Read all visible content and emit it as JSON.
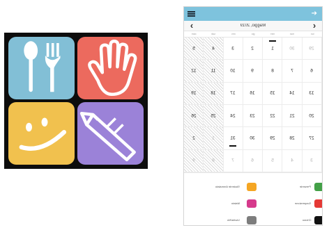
{
  "calendar": {
    "month_title": "Maggio, 2019",
    "weekdays": [
      "dom",
      "sab",
      "ven",
      "gio",
      "mer",
      "mar",
      "lun"
    ],
    "rows": [
      [
        {
          "d": "5",
          "hatch": true
        },
        {
          "d": "4",
          "hatch": true
        },
        {
          "d": "3"
        },
        {
          "d": "2"
        },
        {
          "d": "1",
          "mark": "top"
        },
        {
          "d": "30",
          "dim": true
        },
        {
          "d": "29",
          "dim": true
        }
      ],
      [
        {
          "d": "12",
          "hatch": true
        },
        {
          "d": "11",
          "hatch": true
        },
        {
          "d": "10"
        },
        {
          "d": "9"
        },
        {
          "d": "8"
        },
        {
          "d": "7"
        },
        {
          "d": "6"
        }
      ],
      [
        {
          "d": "19",
          "hatch": true
        },
        {
          "d": "18",
          "hatch": true
        },
        {
          "d": "17"
        },
        {
          "d": "16"
        },
        {
          "d": "15"
        },
        {
          "d": "14"
        },
        {
          "d": "13"
        }
      ],
      [
        {
          "d": "26",
          "hatch": true
        },
        {
          "d": "25",
          "hatch": true
        },
        {
          "d": "24"
        },
        {
          "d": "23"
        },
        {
          "d": "22"
        },
        {
          "d": "21"
        },
        {
          "d": "20"
        }
      ],
      [
        {
          "d": "2",
          "hatch": true
        },
        {
          "d": "1",
          "hatch": true,
          "dim": true
        },
        {
          "d": "31",
          "mark": "bottom"
        },
        {
          "d": "30"
        },
        {
          "d": "29"
        },
        {
          "d": "28"
        },
        {
          "d": "27"
        }
      ],
      [
        {
          "d": "9",
          "hatch": true,
          "dim": true
        },
        {
          "d": "8",
          "hatch": true,
          "dim": true
        },
        {
          "d": "7",
          "dim": true
        },
        {
          "d": "6",
          "dim": true
        },
        {
          "d": "5",
          "dim": true
        },
        {
          "d": "4",
          "dim": true
        },
        {
          "d": "3",
          "dim": true
        }
      ]
    ]
  },
  "legend": {
    "left": [
      {
        "label": "Studente Ammalato",
        "color": "#f5a623"
      },
      {
        "label": "Malato",
        "color": "#d63a8c"
      },
      {
        "label": "Uscita/Mo",
        "color": "#7d7d7d"
      }
    ],
    "right": [
      {
        "label": "Presente",
        "color": "#43a047"
      },
      {
        "label": "Sospensione",
        "color": "#e53935"
      },
      {
        "label": "Chiuso",
        "color": "#111111"
      }
    ]
  },
  "colors": {
    "appbar": "#7ec3dd",
    "logo_food": "#82bfd6",
    "logo_hand": "#ec6a5e",
    "logo_smile": "#f1c14e",
    "logo_pencil": "#9b82d8"
  },
  "icons": {
    "menu": "hamburger-icon",
    "appbar_action": "arrow-right-icon",
    "prev_month": "chevron-left-icon",
    "next_month": "chevron-right-icon",
    "logo_tiles": [
      "spoon-fork-icon",
      "hand-icon",
      "smiley-icon",
      "pencil-icon"
    ]
  }
}
